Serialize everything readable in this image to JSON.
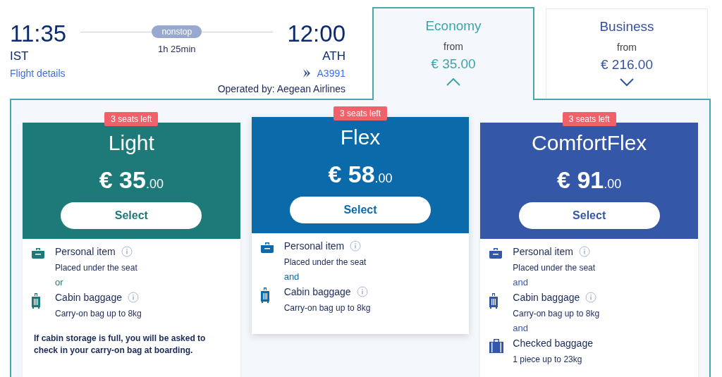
{
  "flight": {
    "depart_time": "11:35",
    "depart_airport": "IST",
    "stops": "nonstop",
    "duration": "1h 25min",
    "arrive_time": "12:00",
    "arrive_airport": "ATH",
    "details_link": "Flight details",
    "flight_number": "A3991",
    "operated_by": "Operated by: Aegean Airlines"
  },
  "cabins": [
    {
      "name": "Economy",
      "from": "from",
      "price": "€ 35.00",
      "selected": true
    },
    {
      "name": "Business",
      "from": "from",
      "price": "€ 216.00",
      "selected": false
    }
  ],
  "fares": [
    {
      "name": "Light",
      "badge": "3 seats left",
      "price_main": "€ 35",
      "price_cents": ".00",
      "button": "Select",
      "color": "#1e7a78",
      "selected": false,
      "items": [
        {
          "kind": "personal",
          "title": "Personal item",
          "detail": "Placed under the seat"
        },
        {
          "kind": "connector",
          "text": "or"
        },
        {
          "kind": "cabin",
          "title": "Cabin baggage",
          "detail": "Carry-on bag up to 8kg"
        },
        {
          "kind": "note",
          "text": "If cabin storage is full, you will be asked to check in your carry-on bag at boarding."
        }
      ]
    },
    {
      "name": "Flex",
      "badge": "3 seats left",
      "price_main": "€ 58",
      "price_cents": ".00",
      "button": "Select",
      "color": "#0b6aaa",
      "selected": true,
      "items": [
        {
          "kind": "personal",
          "title": "Personal item",
          "detail": "Placed under the seat"
        },
        {
          "kind": "connector",
          "text": "and"
        },
        {
          "kind": "cabin",
          "title": "Cabin baggage",
          "detail": "Carry-on bag up to 8kg"
        }
      ]
    },
    {
      "name": "ComfortFlex",
      "badge": "3 seats left",
      "price_main": "€ 91",
      "price_cents": ".00",
      "button": "Select",
      "color": "#3557a8",
      "selected": false,
      "items": [
        {
          "kind": "personal",
          "title": "Personal item",
          "detail": "Placed under the seat"
        },
        {
          "kind": "connector",
          "text": "and"
        },
        {
          "kind": "cabin",
          "title": "Cabin baggage",
          "detail": "Carry-on bag up to 8kg"
        },
        {
          "kind": "connector",
          "text": "and"
        },
        {
          "kind": "checked",
          "title": "Checked baggage",
          "detail": "1 piece up to 23kg"
        }
      ]
    }
  ]
}
